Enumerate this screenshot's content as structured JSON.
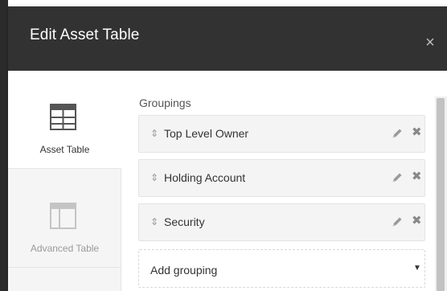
{
  "modal": {
    "title": "Edit Asset Table",
    "close_glyph": "×"
  },
  "sidebar": {
    "items": [
      {
        "label": "Asset Table",
        "icon": "asset-table-icon",
        "active": true
      },
      {
        "label": "Advanced Table",
        "icon": "advanced-table-icon",
        "active": false
      }
    ]
  },
  "groupings": {
    "label": "Groupings",
    "items": [
      {
        "name": "Top Level Owner"
      },
      {
        "name": "Holding Account"
      },
      {
        "name": "Security"
      }
    ],
    "handle_glyph": "⇕",
    "remove_glyph": "✖",
    "add_label": "Add grouping",
    "caret_glyph": "▼"
  },
  "colors": {
    "header_bg": "#323232",
    "sidebar_bg": "#f5f5f5",
    "row_bg": "#f4f4f4"
  }
}
